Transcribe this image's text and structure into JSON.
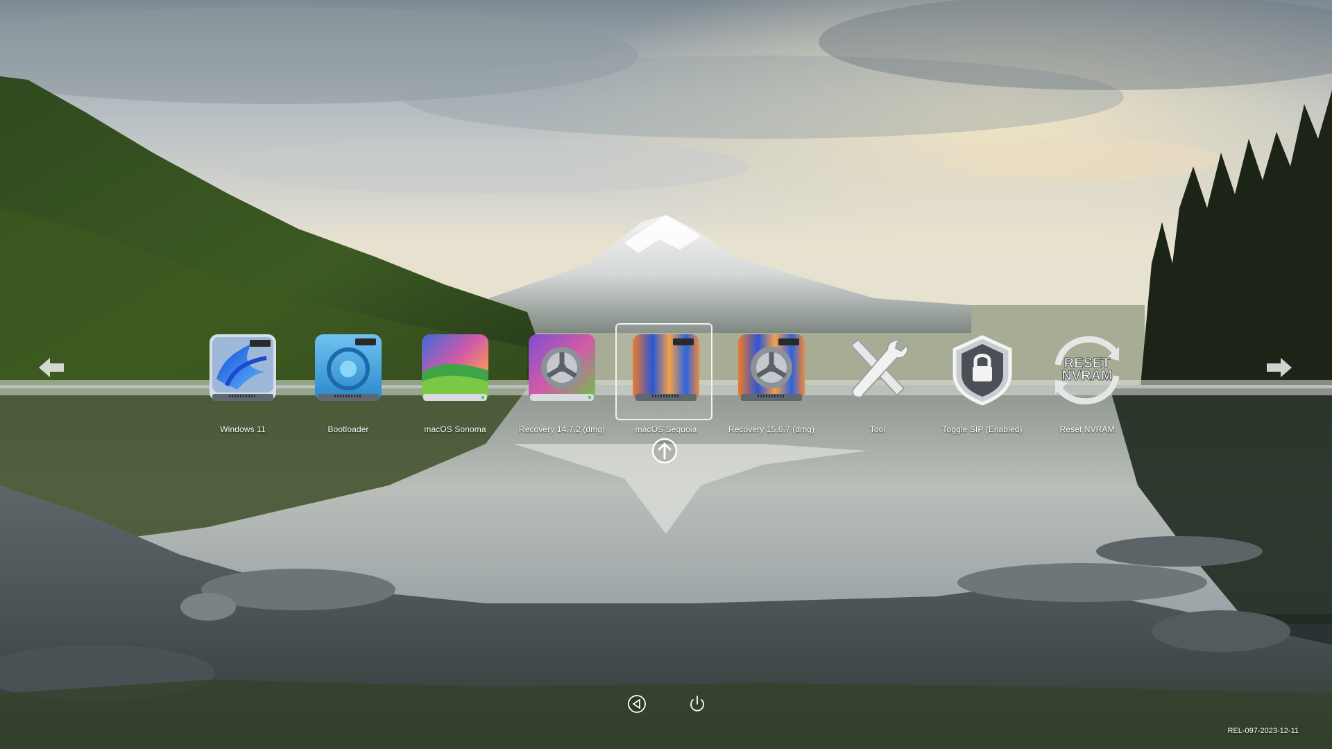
{
  "screen": {
    "type": "boot picker"
  },
  "entries": [
    {
      "label": "Windows 11",
      "icon": "windows-drive-icon",
      "selected": false
    },
    {
      "label": "Bootloader",
      "icon": "bootloader-drive-icon",
      "selected": false
    },
    {
      "label": "macOS Sonoma",
      "icon": "macos-sonoma-drive-icon",
      "selected": false
    },
    {
      "label": "Recovery 14.7.2 (dmg)",
      "icon": "recovery-gear-drive-icon",
      "selected": false
    },
    {
      "label": "macOS Sequoia",
      "icon": "macos-sequoia-drive-icon",
      "selected": true
    },
    {
      "label": "Recovery 15.6.7 (dmg)",
      "icon": "recovery-sequoia-gear-drive-icon",
      "selected": false
    },
    {
      "label": "Tool",
      "icon": "tools-icon",
      "selected": false
    },
    {
      "label": "Toggle SIP (Enabled)",
      "icon": "shield-lock-icon",
      "selected": false
    },
    {
      "label": "Reset NVRAM",
      "icon": "reset-nvram-icon",
      "icon_text": [
        "RESET",
        "NVRAM"
      ],
      "selected": false
    }
  ],
  "navigation": {
    "left_arrow_icon": "arrow-left-icon",
    "right_arrow_icon": "arrow-right-icon",
    "selected_hint_icon": "arrow-up-circle-icon"
  },
  "bottom_controls": [
    {
      "name": "restart",
      "icon": "restart-icon"
    },
    {
      "name": "shutdown",
      "icon": "power-icon"
    }
  ],
  "version": "REL-097-2023-12-11",
  "colors": {
    "label": "#ffffff",
    "selection": "#f2f2f2"
  }
}
